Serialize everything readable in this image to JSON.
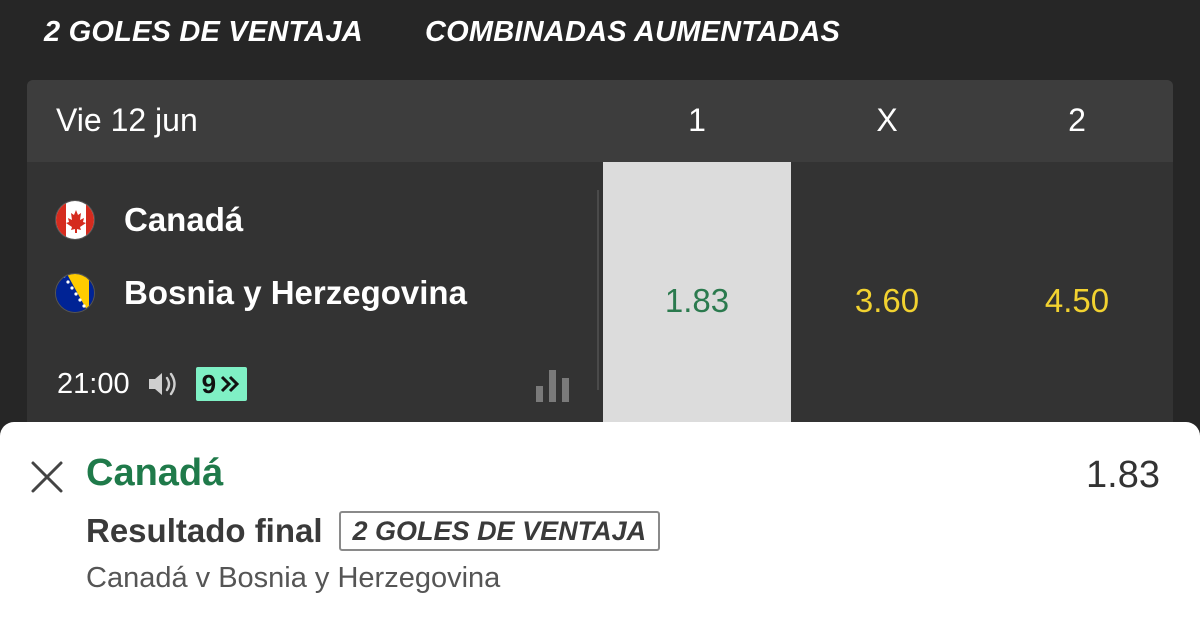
{
  "tabs": [
    "2 GOLES DE VENTAJA",
    "COMBINADAS AUMENTADAS"
  ],
  "header": {
    "date": "Vie 12 jun",
    "columns": [
      "1",
      "X",
      "2"
    ]
  },
  "event": {
    "home_team": "Canadá",
    "away_team": "Bosnia y Herzegovina",
    "home_flag": "canada-flag",
    "away_flag": "bosnia-flag",
    "time": "21:00",
    "badge": "9",
    "odds": [
      "1.83",
      "3.60",
      "4.50"
    ],
    "selected_odd_index": 0
  },
  "bet_slip": {
    "selection": "Canadá",
    "odd": "1.83",
    "market": "Resultado final",
    "boost_label": "2 GOLES DE VENTAJA",
    "event_name": "Canadá v Bosnia y Herzegovina"
  },
  "colors": {
    "background": "#262626",
    "card": "#333333",
    "odd_text": "#f2d230",
    "selected_bg": "#dcdcdc",
    "selected_text": "#2b7a4e",
    "accent_green": "#1f7a4a",
    "badge_bg": "#7ff0c5"
  }
}
